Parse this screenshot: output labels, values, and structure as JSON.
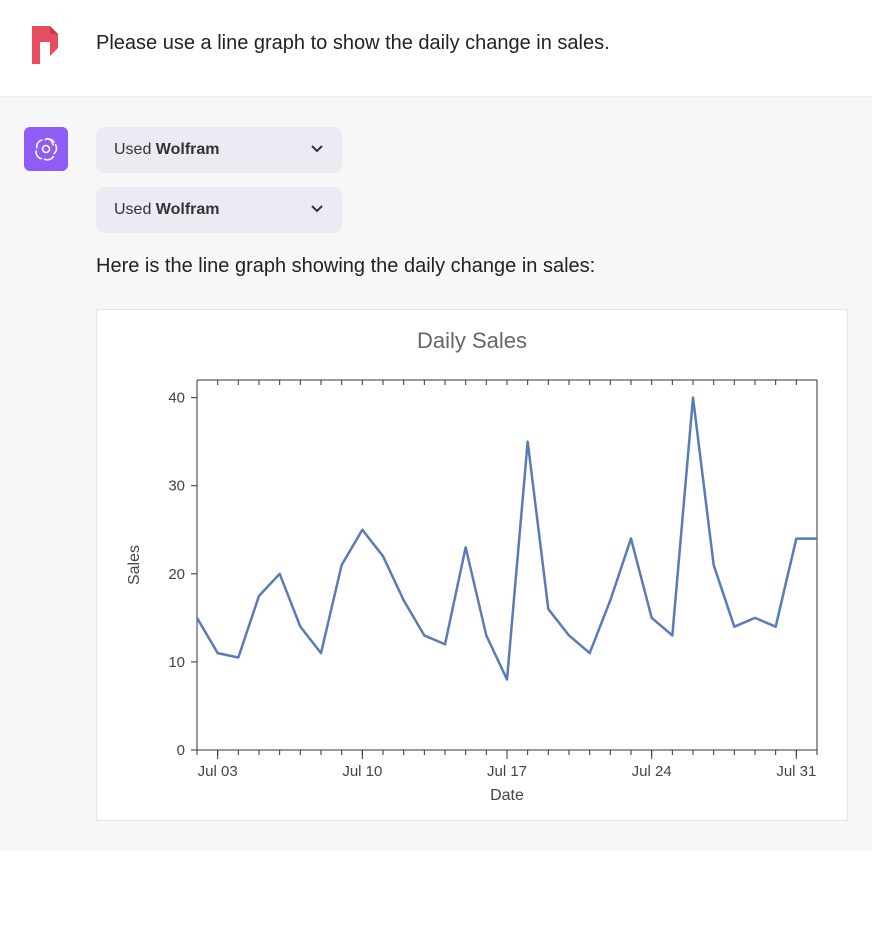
{
  "user": {
    "prompt": "Please use a line graph to show the daily change in sales."
  },
  "assistant": {
    "pills": [
      {
        "prefix": "Used ",
        "tool": "Wolfram"
      },
      {
        "prefix": "Used ",
        "tool": "Wolfram"
      }
    ],
    "response": "Here is the line graph showing the daily change in sales:"
  },
  "chart_data": {
    "type": "line",
    "title": "Daily Sales",
    "xlabel": "Date",
    "ylabel": "Sales",
    "ylim": [
      0,
      42
    ],
    "y_ticks": [
      0,
      10,
      20,
      30,
      40
    ],
    "x_tick_labels": [
      "Jul 03",
      "Jul 10",
      "Jul 17",
      "Jul 24",
      "Jul 31"
    ],
    "x_tick_indices": [
      2,
      9,
      16,
      23,
      30
    ],
    "x": [
      1,
      2,
      3,
      4,
      5,
      6,
      7,
      8,
      9,
      10,
      11,
      12,
      13,
      14,
      15,
      16,
      17,
      18,
      19,
      20,
      21,
      22,
      23,
      24,
      25,
      26,
      27,
      28,
      29,
      30,
      31
    ],
    "values": [
      15,
      11,
      10.5,
      17.5,
      20,
      14,
      11,
      21,
      25,
      22,
      17,
      13,
      12,
      23,
      13,
      8,
      35,
      16,
      13,
      11,
      17,
      24,
      15,
      13,
      40,
      21,
      14,
      15,
      14,
      24,
      24
    ]
  }
}
